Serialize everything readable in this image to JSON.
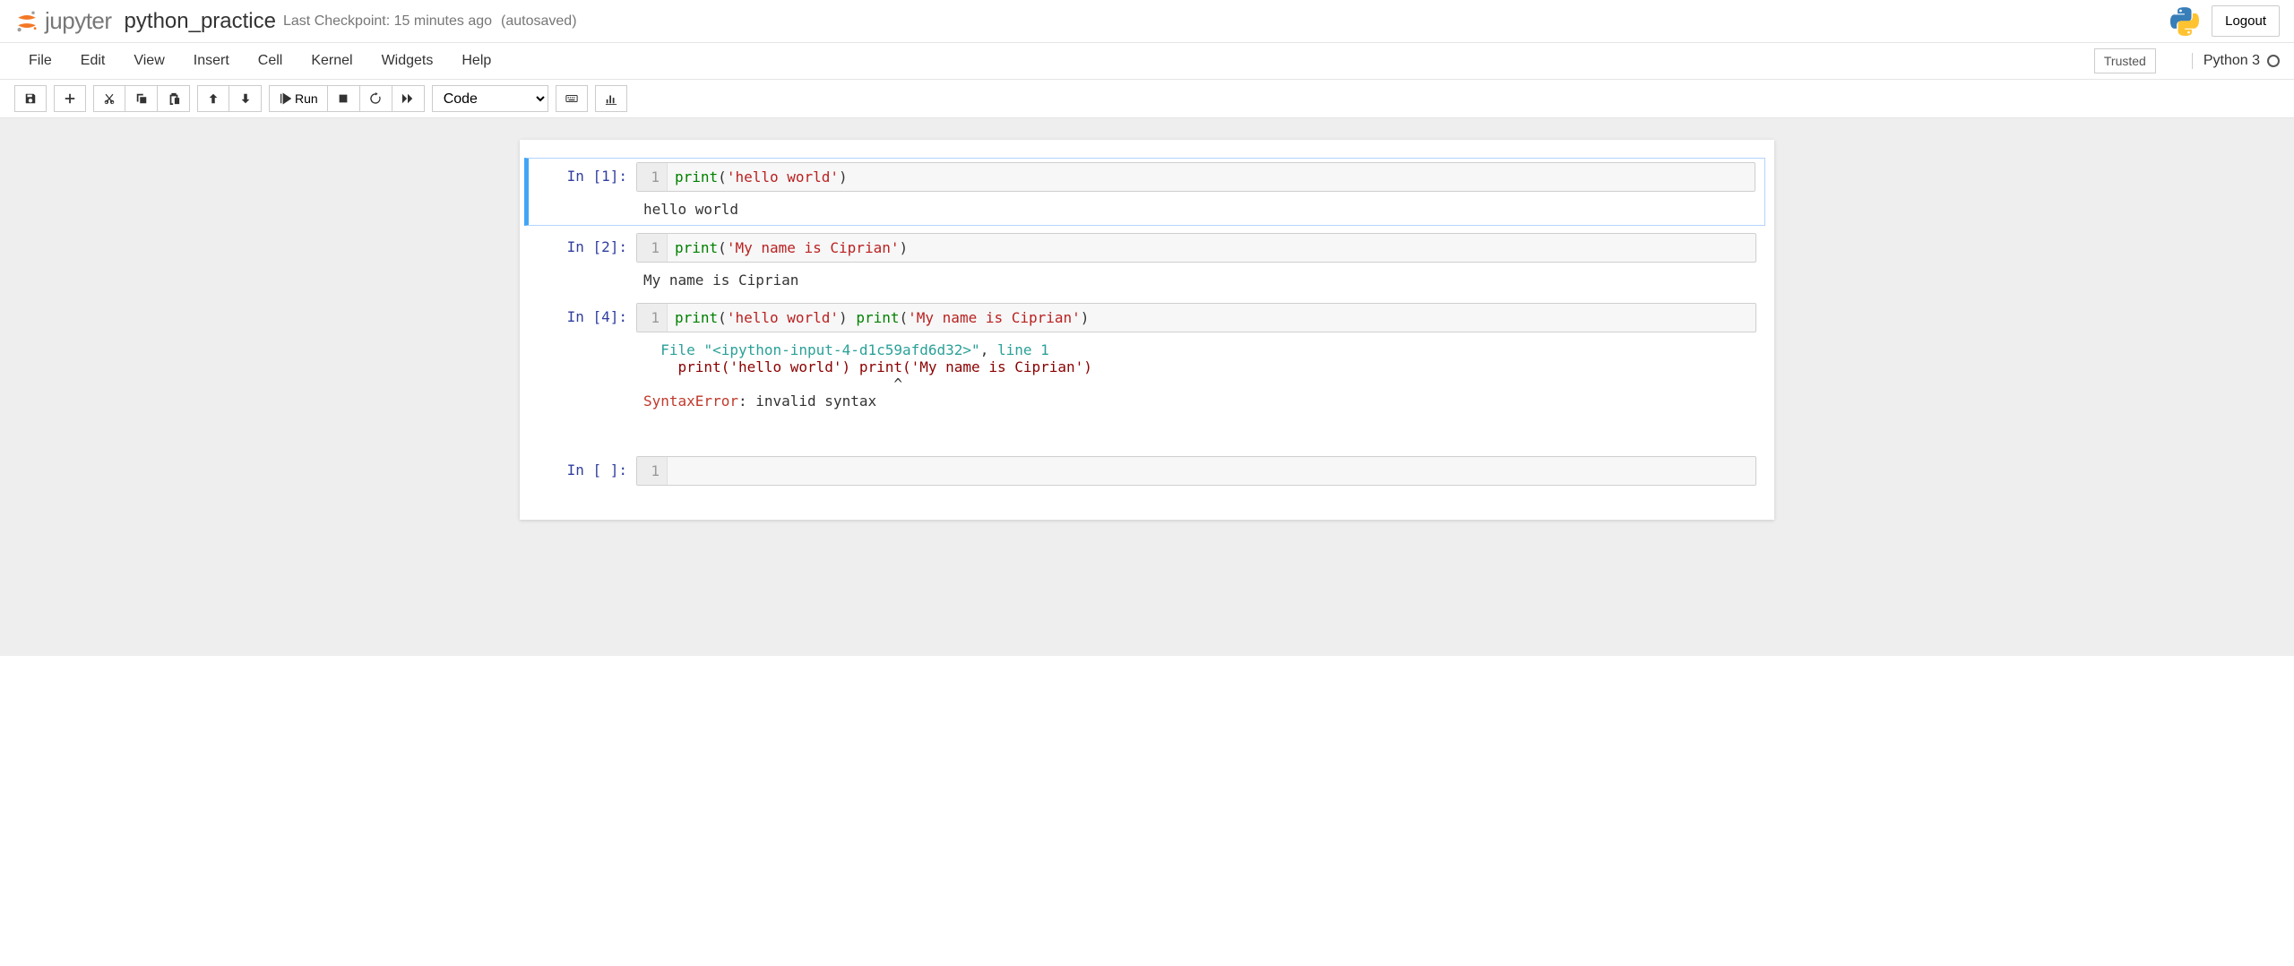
{
  "header": {
    "logo_text": "jupyter",
    "notebook_name": "python_practice",
    "checkpoint": "Last Checkpoint: 15 minutes ago",
    "autosave": "(autosaved)",
    "logout": "Logout"
  },
  "menubar": {
    "items": [
      "File",
      "Edit",
      "View",
      "Insert",
      "Cell",
      "Kernel",
      "Widgets",
      "Help"
    ],
    "trusted": "Trusted",
    "kernel": "Python 3"
  },
  "toolbar": {
    "run": "Run",
    "cell_type": "Code"
  },
  "cells": [
    {
      "prompt": "In [1]:",
      "line_no": "1",
      "code_fn": "print",
      "code_paren_open": "(",
      "code_str": "'hello world'",
      "code_paren_close": ")",
      "output": "hello world"
    },
    {
      "prompt": "In [2]:",
      "line_no": "1",
      "code_fn": "print",
      "code_paren_open": "(",
      "code_str": "'My name is Ciprian'",
      "code_paren_close": ")",
      "output": "My name is Ciprian"
    },
    {
      "prompt": "In [4]:",
      "line_no": "1",
      "code_fn1": "print",
      "code_p1o": "(",
      "code_str1": "'hello world'",
      "code_p1c": ")",
      "code_sep": " ",
      "code_fn2": "print",
      "code_p2o": "(",
      "code_str2": "'My name is Ciprian'",
      "code_p2c": ")",
      "err_file_label": "  File ",
      "err_file": "\"<ipython-input-4-d1c59afd6d32>\"",
      "err_comma": ", ",
      "err_line_label": "line ",
      "err_line_no": "1",
      "err_code": "    print('hello world') print('My name is Ciprian')",
      "err_caret": "                             ^",
      "err_name": "SyntaxError",
      "err_colon": ": ",
      "err_msg": "invalid syntax"
    },
    {
      "prompt": "In [ ]:",
      "line_no": "1"
    }
  ]
}
